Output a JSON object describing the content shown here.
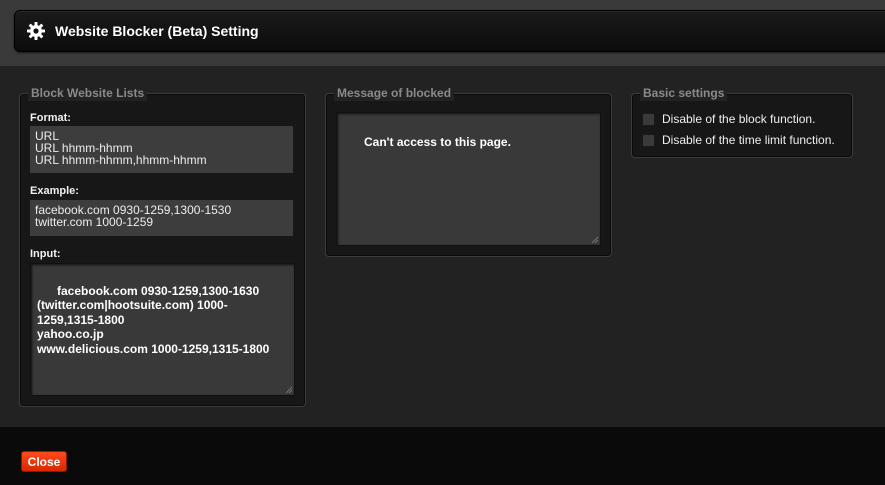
{
  "window": {
    "title": "Website Blocker (Beta) Setting"
  },
  "block_lists": {
    "legend": "Block Website Lists",
    "format_label": "Format:",
    "format_value": "URL\nURL hhmm-hhmm\nURL hhmm-hhmm,hhmm-hhmm",
    "example_label": "Example:",
    "example_value": "facebook.com 0930-1259,1300-1530\ntwitter.com 1000-1259",
    "input_label": "Input:",
    "input_value": "facebook.com 0930-1259,1300-1630\n(twitter.com|hootsuite.com) 1000-1259,1315-1800\nyahoo.co.jp\nwww.delicious.com 1000-1259,1315-1800"
  },
  "message": {
    "legend": "Message of blocked",
    "value": "Can't access to this page."
  },
  "basic_settings": {
    "legend": "Basic settings",
    "options": [
      {
        "label": "Disable of the block function.",
        "checked": false
      },
      {
        "label": "Disable of the time limit function.",
        "checked": false
      }
    ]
  },
  "footer": {
    "close_label": "Close"
  },
  "colors": {
    "accent": "#ff3a10",
    "panel_bg": "#171717",
    "page_bg": "#222222"
  },
  "icons": {
    "title_icon": "gear-icon"
  }
}
